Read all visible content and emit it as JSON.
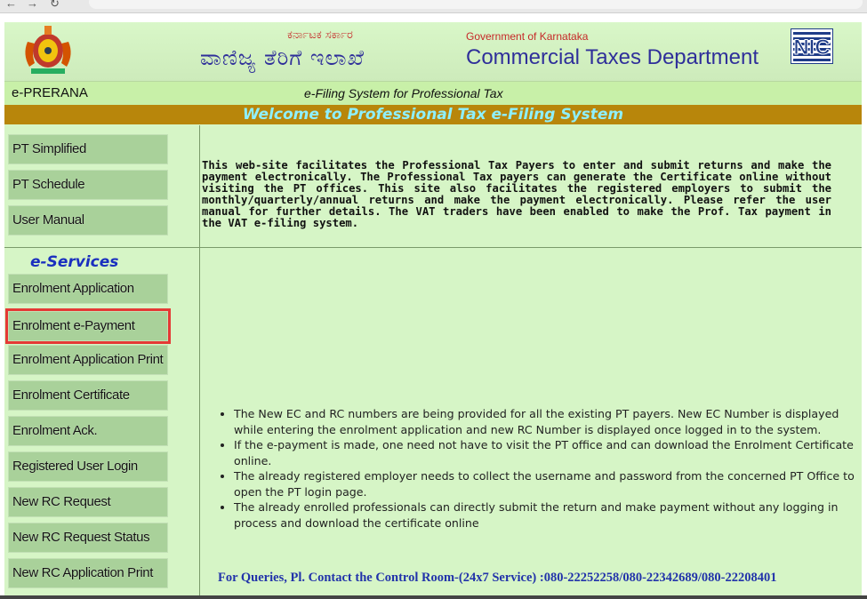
{
  "header": {
    "kn_line1": "ಕರ್ನಾಟಕ ಸರ್ಕಾರ",
    "kn_line2": "ವಾಣಿಜ್ಯ ತೆರಿಗೆ ಇಲಾಖೆ",
    "en_line1": "Government of Karnataka",
    "en_line2": "Commercial Taxes Department",
    "nic_logo": "NIC"
  },
  "subbar": {
    "left": "e-PRERANA",
    "center": "e-Filing System for Professional Tax"
  },
  "welcome": "Welcome to Professional Tax e-Filing System",
  "top_menu": [
    {
      "label": "PT Simplified"
    },
    {
      "label": "PT Schedule"
    },
    {
      "label": "User Manual"
    }
  ],
  "intro": "This web-site facilitates the Professional Tax Payers to enter and submit returns and make the payment electronically. The Professional Tax payers can generate the Certificate online without visiting the PT offices. This site also facilitates the registered employers to submit the monthly/quarterly/annual returns and make the payment electronically. Please refer the user manual for further details. The VAT traders have been enabled to make the Prof. Tax payment in the VAT e-filing system.",
  "eservices": {
    "title": "e-Services",
    "items": [
      {
        "label": "Enrolment Application"
      },
      {
        "label": "Enrolment e-Payment"
      },
      {
        "label": "Enrolment Application Print"
      },
      {
        "label": "Enrolment Certificate"
      },
      {
        "label": "Enrolment Ack."
      },
      {
        "label": "Registered User Login"
      },
      {
        "label": "New RC Request"
      },
      {
        "label": "New RC Request Status"
      },
      {
        "label": "New RC Application Print"
      }
    ]
  },
  "bullets": [
    "The New EC and RC numbers are being provided for all the existing PT payers. New EC Number is displayed while entering the enrolment application and new RC Number is displayed once logged in to the system.",
    "If the e-payment is made, one need not have to visit the PT office and can download the Enrolment Certificate online.",
    "The already registered employer needs to collect the username and password from the concerned PT Office to open the PT login page.",
    "The already enrolled professionals can directly submit the return and make payment without any logging in process and download the certificate online"
  ],
  "contact": "For Queries, Pl. Contact the Control Room-(24x7 Service) :080-22252258/080-22342689/080-22208401",
  "colors": {
    "welcome_bg": "#b8860b",
    "welcome_text": "#8ef0ff",
    "page_bg": "#d6f5c6",
    "menu_button": "#a9d19a",
    "highlight_box": "#e53935",
    "heading_blue": "#2f2f9a"
  }
}
